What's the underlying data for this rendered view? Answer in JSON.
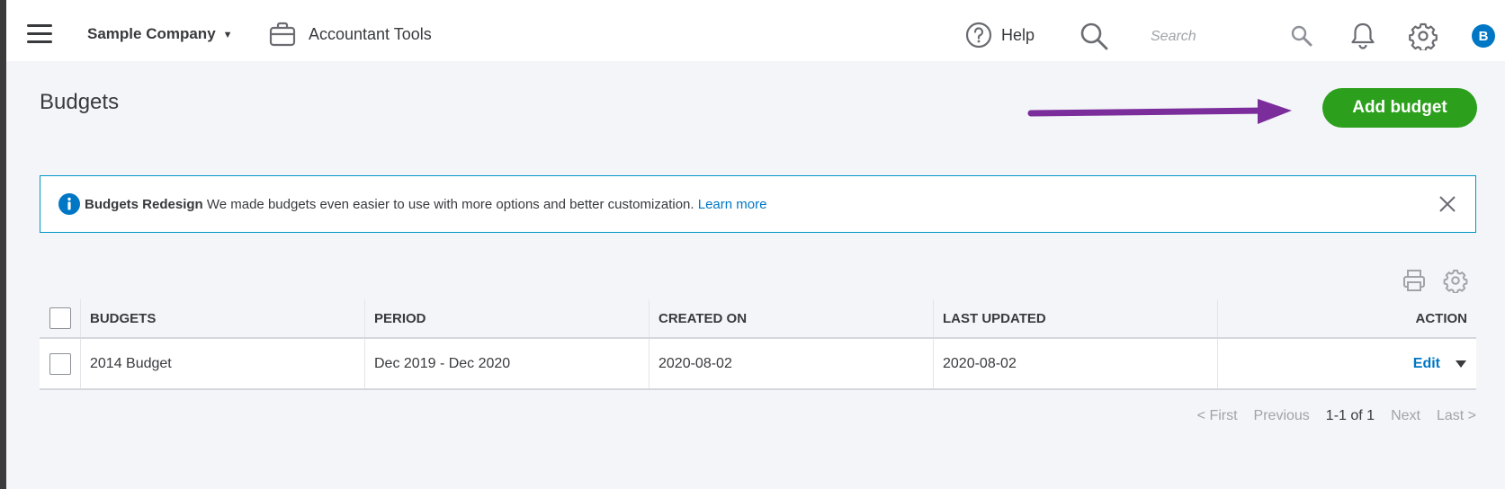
{
  "header": {
    "company_name": "Sample Company",
    "accountant_tools_label": "Accountant Tools",
    "help_label": "Help",
    "search_placeholder": "Search",
    "avatar_initial": "B"
  },
  "page": {
    "title": "Budgets",
    "add_button_label": "Add budget"
  },
  "banner": {
    "title": "Budgets Redesign",
    "message": "We made budgets even easier to use with more options and better customization.",
    "link_label": "Learn more"
  },
  "table": {
    "columns": [
      "BUDGETS",
      "PERIOD",
      "CREATED ON",
      "LAST UPDATED",
      "ACTION"
    ],
    "rows": [
      {
        "name": "2014 Budget",
        "period": "Dec 2019 - Dec 2020",
        "created_on": "2020-08-02",
        "last_updated": "2020-08-02",
        "action": "Edit"
      }
    ]
  },
  "pagination": {
    "first": "< First",
    "previous": "Previous",
    "range": "1-1 of 1",
    "next": "Next",
    "last": "Last >"
  },
  "colors": {
    "primary_green": "#2ca01c",
    "link_blue": "#0077c5",
    "banner_border": "#0097c7",
    "annotation_arrow": "#7b2d9c"
  },
  "icons": [
    "hamburger-menu-icon",
    "chevron-down-icon",
    "briefcase-icon",
    "help-circle-icon",
    "search-icon",
    "bell-icon",
    "gear-icon",
    "info-icon",
    "close-icon",
    "print-icon",
    "caret-down-icon"
  ]
}
